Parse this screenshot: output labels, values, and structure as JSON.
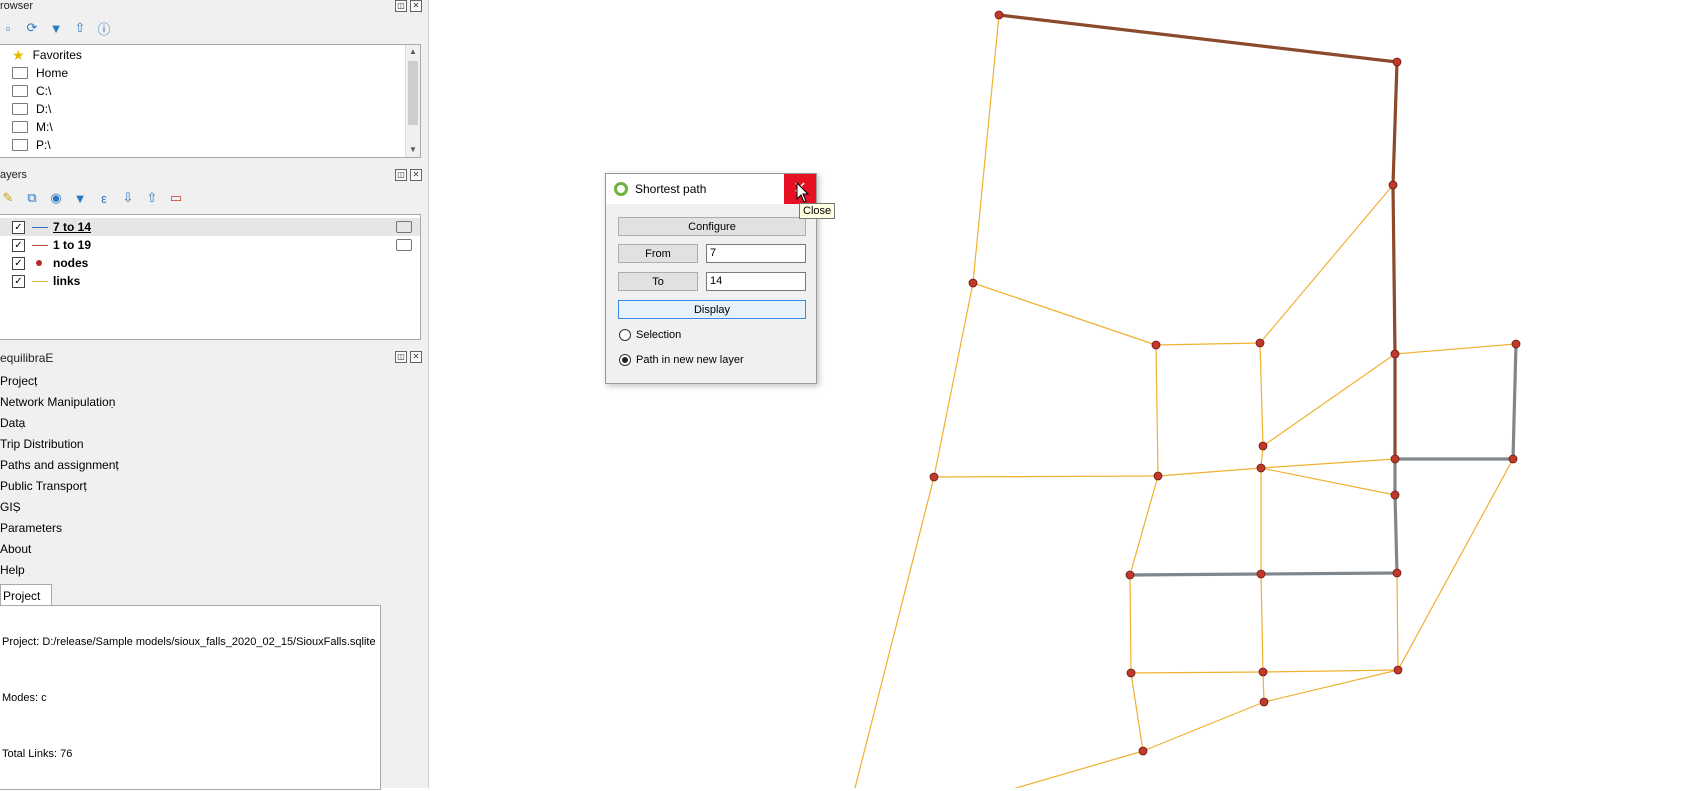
{
  "browser": {
    "title": "rowser",
    "items": [
      {
        "label": "Favorites",
        "icon": "star-icon"
      },
      {
        "label": "Home",
        "icon": "home-folder-icon"
      },
      {
        "label": "C:\\",
        "icon": "folder-icon"
      },
      {
        "label": "D:\\",
        "icon": "folder-icon"
      },
      {
        "label": "M:\\",
        "icon": "folder-icon"
      },
      {
        "label": "P:\\",
        "icon": "folder-icon"
      }
    ]
  },
  "layers": {
    "title": "ayers",
    "items": [
      {
        "label": "7 to 14",
        "checked": "✓",
        "color": "#2a6ebb",
        "type": "line",
        "selected": true
      },
      {
        "label": "1 to 19",
        "checked": "✓",
        "color": "#b04a3a",
        "type": "line"
      },
      {
        "label": "nodes",
        "checked": "✓",
        "color": "#b42a2a",
        "type": "point"
      },
      {
        "label": "links",
        "checked": "✓",
        "color": "#e8b33c",
        "type": "line"
      }
    ]
  },
  "aequilibrae": {
    "title": "equilibraE",
    "menu": [
      "Project",
      "Network Manipulation",
      "Data",
      "Trip Distribution",
      "Paths and assignment",
      "Public Transport",
      "GIS",
      "Parameters",
      "About",
      "Help"
    ],
    "tab": "Project",
    "info": {
      "project": "Project: D:/release/Sample models/sioux_falls_2020_02_15/SiouxFalls.sqlite",
      "modes": "Modes: c",
      "links": "Total Links: 76"
    }
  },
  "dialog": {
    "title": "Shortest path",
    "configure": "Configure",
    "from_label": "From",
    "from_value": "7",
    "to_label": "To",
    "to_value": "14",
    "display": "Display",
    "radio_selection": "Selection",
    "radio_newlayer": "Path in new new layer",
    "close_glyph": "✕"
  },
  "tooltip": "Close",
  "colors": {
    "link": "#f0b030",
    "path_brown": "#8b4a2b",
    "path_gray": "#7f868c",
    "node": "#c0392b"
  }
}
